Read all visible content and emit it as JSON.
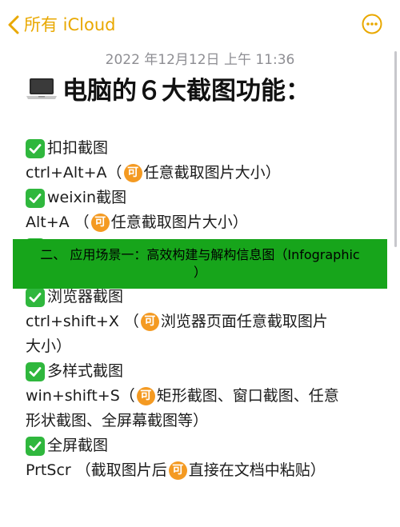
{
  "navbar": {
    "back_label": "所有 iCloud"
  },
  "note": {
    "timestamp": "2022 年12月12日 上午 11:36",
    "title": "电脑的６大截图功能：",
    "items": [
      {
        "heading": "扣扣截图",
        "shortcut": "ctrl+Alt+A（",
        "desc": "任意截取图片大小）"
      },
      {
        "heading": "weixin截图",
        "shortcut": "Alt+A （",
        "desc": "任意截取图片大小）"
      },
      {
        "heading": "浏览器截图",
        "shortcut": "ctrl+shift+X （",
        "desc": "浏览器页面任意截取图片",
        "desc2": "大小）"
      },
      {
        "heading": "多样式截图",
        "shortcut": "win+shift+S（",
        "desc": "矩形截图、窗口截图、任意",
        "desc2": "形状截图、全屏幕截图等）"
      },
      {
        "heading": "全屏截图",
        "shortcut": "PrtScr （截取图片后",
        "desc": "直接在文档中粘贴）"
      }
    ]
  },
  "banner": {
    "text": "二、 应用场景一：高效构建与解构信息图（Infographic",
    "text2": "）"
  },
  "icons": {
    "ke_glyph": "可"
  },
  "colors": {
    "accent": "#e9a800",
    "check_green": "#2fb73d",
    "badge_orange": "#f49a22",
    "banner_green": "#17a51b"
  }
}
